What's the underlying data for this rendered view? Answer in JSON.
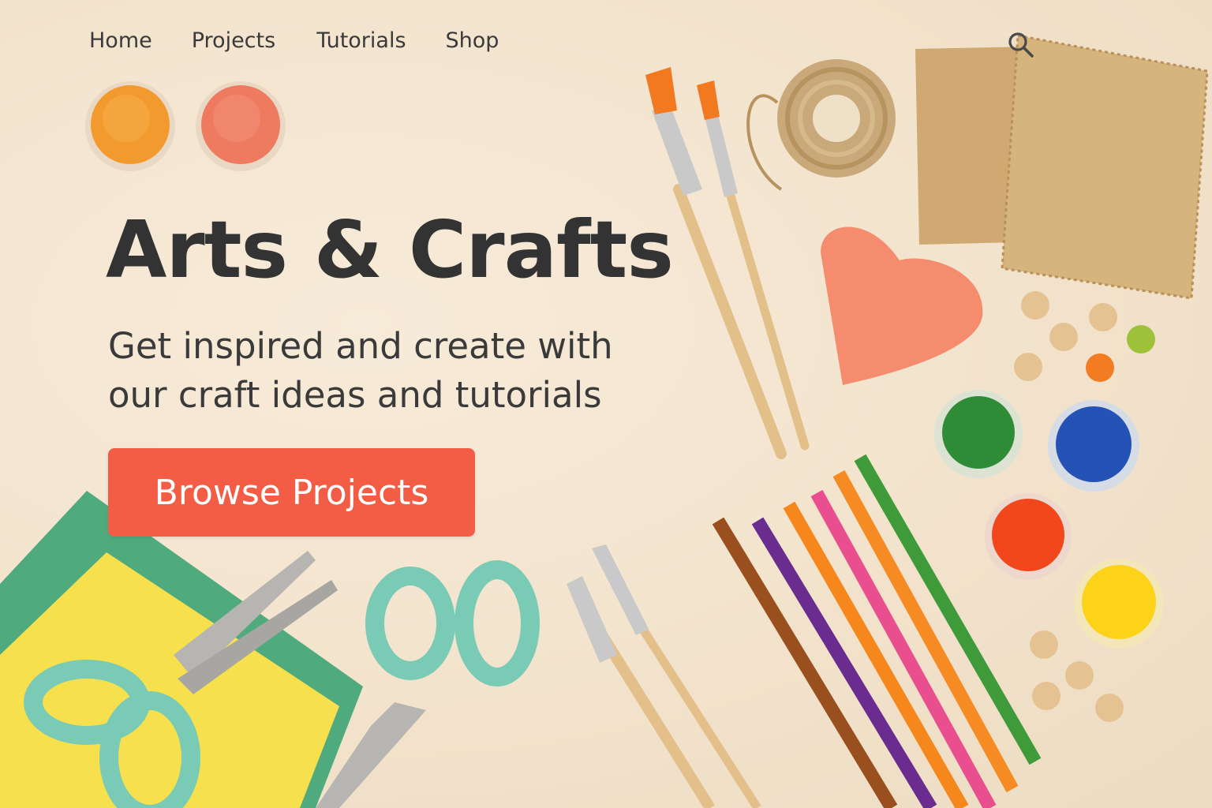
{
  "nav": {
    "items": [
      {
        "label": "Home"
      },
      {
        "label": "Projects"
      },
      {
        "label": "Tutorials"
      },
      {
        "label": "Shop"
      }
    ]
  },
  "search": {
    "icon": "search-icon"
  },
  "hero": {
    "title": "Arts & Crafts",
    "subtitle": "Get inspired and create with our craft ideas and tutorials",
    "cta_label": "Browse Projects"
  },
  "colors": {
    "background": "#f3e4cf",
    "accent": "#f45d45",
    "text": "#333333"
  }
}
